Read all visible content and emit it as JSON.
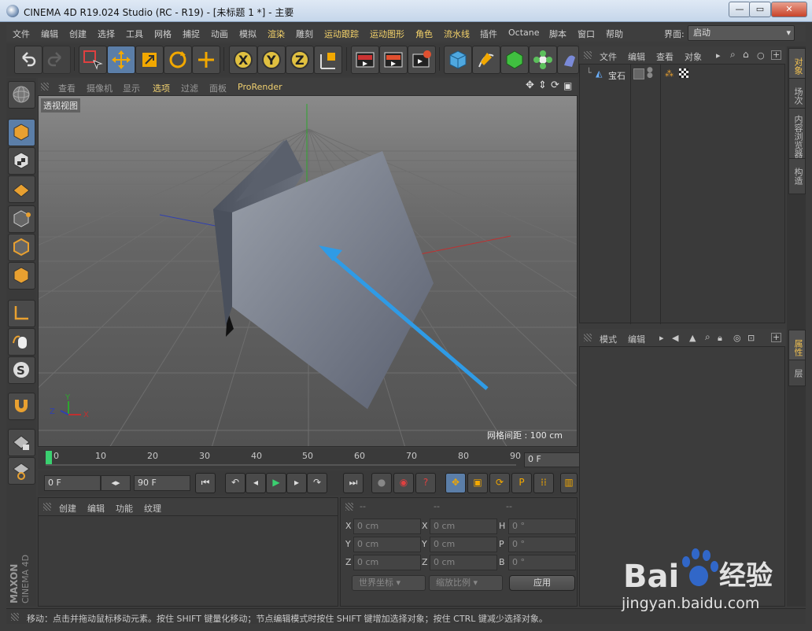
{
  "window": {
    "title": "CINEMA 4D R19.024 Studio (RC - R19) - [未标题 1 *] - 主要",
    "buttons": {
      "minimize": "—",
      "maximize": "▭",
      "close": "✕"
    }
  },
  "menubar": {
    "items": [
      {
        "label": "文件",
        "highlight": false
      },
      {
        "label": "编辑",
        "highlight": false
      },
      {
        "label": "创建",
        "highlight": false
      },
      {
        "label": "选择",
        "highlight": false
      },
      {
        "label": "工具",
        "highlight": false
      },
      {
        "label": "网格",
        "highlight": false
      },
      {
        "label": "捕捉",
        "highlight": false
      },
      {
        "label": "动画",
        "highlight": false
      },
      {
        "label": "模拟",
        "highlight": false
      },
      {
        "label": "渲染",
        "highlight": true
      },
      {
        "label": "雕刻",
        "highlight": false
      },
      {
        "label": "运动跟踪",
        "highlight": true
      },
      {
        "label": "运动图形",
        "highlight": true
      },
      {
        "label": "角色",
        "highlight": true
      },
      {
        "label": "流水线",
        "highlight": true
      },
      {
        "label": "插件",
        "highlight": false
      },
      {
        "label": "Octane",
        "highlight": false
      },
      {
        "label": "脚本",
        "highlight": false
      },
      {
        "label": "窗口",
        "highlight": false
      },
      {
        "label": "帮助",
        "highlight": false
      }
    ],
    "layout_label": "界面:",
    "layout_value": "启动"
  },
  "viewport": {
    "menu": [
      "查看",
      "摄像机",
      "显示",
      "选项",
      "过滤",
      "面板",
      "ProRender"
    ],
    "label": "透视视图",
    "grid_spacing": "网格间距 : 100 cm",
    "axis_labels": {
      "y": "Y",
      "x": "X",
      "z": "Z"
    }
  },
  "timeline": {
    "ticks": [
      "0",
      "10",
      "20",
      "30",
      "40",
      "50",
      "60",
      "70",
      "80",
      "90"
    ],
    "current_frame": "0 F",
    "start_frame": "0 F",
    "end_frame": "90 F"
  },
  "material_panel": {
    "menu": [
      "创建",
      "编辑",
      "功能",
      "纹理"
    ]
  },
  "coordinates": {
    "headers": [
      "--",
      "--",
      "--"
    ],
    "rows": [
      {
        "l1": "X",
        "v1": "0 cm",
        "l2": "X",
        "v2": "0 cm",
        "l3": "H",
        "v3": "0 °"
      },
      {
        "l1": "Y",
        "v1": "0 cm",
        "l2": "Y",
        "v2": "0 cm",
        "l3": "P",
        "v3": "0 °"
      },
      {
        "l1": "Z",
        "v1": "0 cm",
        "l2": "Z",
        "v2": "0 cm",
        "l3": "B",
        "v3": "0 °"
      }
    ],
    "world_coords": "世界坐标",
    "scale_ratio": "缩放比例",
    "apply": "应用"
  },
  "object_manager": {
    "menu": [
      "文件",
      "编辑",
      "查看",
      "对象"
    ],
    "objects": [
      {
        "name": "宝石"
      }
    ]
  },
  "attribute_manager": {
    "menu": [
      "模式",
      "编辑"
    ]
  },
  "right_tabs": {
    "top": [
      "对象",
      "场次",
      "内容浏览器",
      "构造"
    ],
    "bottom": [
      "属性",
      "层"
    ]
  },
  "statusbar": {
    "text": "移动：点击并拖动鼠标移动元素。按住 SHIFT 键量化移动；节点编辑模式时按住 SHIFT 键增加选择对象；按住 CTRL 键减少选择对象。"
  },
  "sidebar_logo": {
    "text": "MAXON CINEMA 4D"
  },
  "watermark": {
    "brand": "Bai",
    "brand2": "经验",
    "url": "jingyan.baidu.com"
  },
  "colors": {
    "accent_select": "#5b7ea8",
    "highlight_menu": "#f5d36a",
    "arrow": "#2f9be6"
  }
}
